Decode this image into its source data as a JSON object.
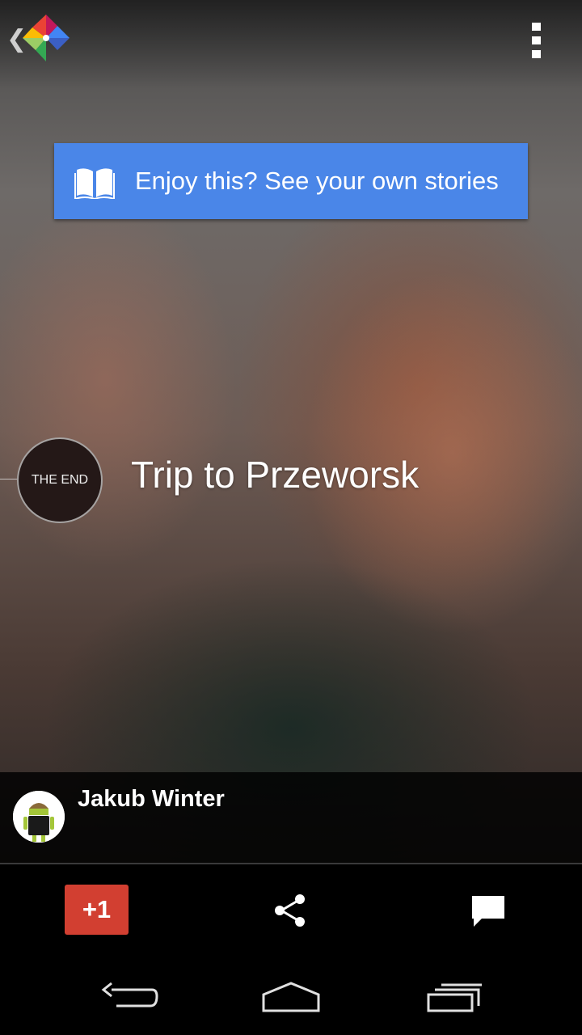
{
  "app": {
    "logo_icon": "photos-pinwheel-icon",
    "back_icon": "chevron-left-icon",
    "menu_icon": "overflow-menu-icon"
  },
  "banner": {
    "text": "Enjoy this? See your own stories",
    "icon": "open-book-icon",
    "color": "#4a86e8"
  },
  "story": {
    "end_label": "THE END",
    "title": "Trip to Przeworsk"
  },
  "owner": {
    "name": "Jakub Winter",
    "avatar_icon": "android-avatar-icon"
  },
  "actions": {
    "plus_one_label": "+1",
    "plus_one_color": "#d23f31",
    "share_icon": "share-icon",
    "comment_icon": "comment-icon"
  },
  "system_nav": {
    "back_icon": "nav-back-icon",
    "home_icon": "nav-home-icon",
    "recents_icon": "nav-recents-icon"
  }
}
